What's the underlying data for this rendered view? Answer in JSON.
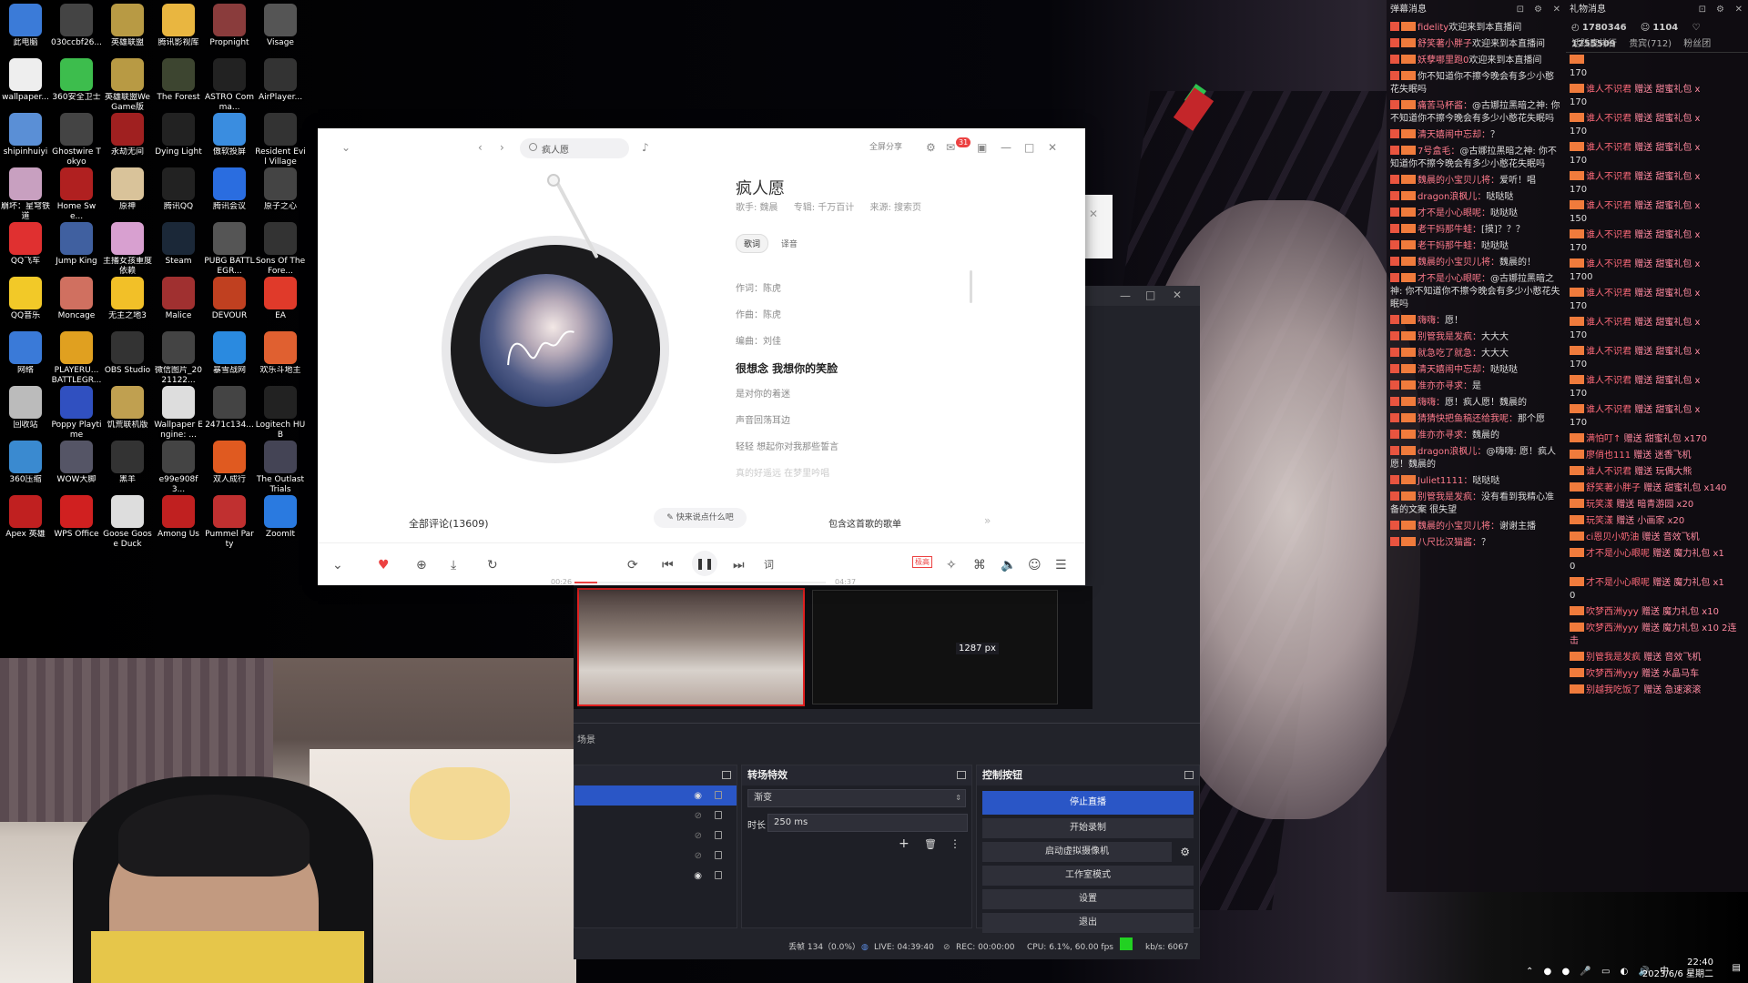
{
  "desktop": {
    "icons": [
      {
        "label": "此电脑",
        "color": "#3b7bd8"
      },
      {
        "label": "030ccbf26...",
        "color": "#444"
      },
      {
        "label": "英雄联盟",
        "color": "#b89a44"
      },
      {
        "label": "腾讯影视库",
        "color": "#e9b640"
      },
      {
        "label": "Propnight",
        "color": "#8a3c3c"
      },
      {
        "label": "Visage",
        "color": "#555"
      },
      {
        "label": "wallpaper...",
        "color": "#eee"
      },
      {
        "label": "360安全卫士",
        "color": "#3dbd4d"
      },
      {
        "label": "英雄联盟WeGame版",
        "color": "#b89a44"
      },
      {
        "label": "The Forest",
        "color": "#3d4530"
      },
      {
        "label": "ASTRO Comma...",
        "color": "#222"
      },
      {
        "label": "AirPlayer...",
        "color": "#333"
      },
      {
        "label": "shipinhuiyi",
        "color": "#5a8fd6"
      },
      {
        "label": "Ghostwire Tokyo",
        "color": "#444"
      },
      {
        "label": "永劫无间",
        "color": "#a02020"
      },
      {
        "label": "Dying Light",
        "color": "#222"
      },
      {
        "label": "傲软投屏",
        "color": "#3a8de0"
      },
      {
        "label": "Resident Evil Village",
        "color": "#333"
      },
      {
        "label": "崩坏：星穹铁道",
        "color": "#c8a0c0"
      },
      {
        "label": "Home Swe...",
        "color": "#b02020"
      },
      {
        "label": "原神",
        "color": "#d9c39a"
      },
      {
        "label": "腾讯QQ",
        "color": "#222"
      },
      {
        "label": "腾讯会议",
        "color": "#2a6de0"
      },
      {
        "label": "原子之心",
        "color": "#444"
      },
      {
        "label": "QQ飞车",
        "color": "#e03030"
      },
      {
        "label": "Jump King",
        "color": "#4060a0"
      },
      {
        "label": "主播女孩重度依赖",
        "color": "#d8a0d0"
      },
      {
        "label": "Steam",
        "color": "#1b2838"
      },
      {
        "label": "PUBG BATTLEGR...",
        "color": "#555"
      },
      {
        "label": "Sons Of The Fore...",
        "color": "#333"
      },
      {
        "label": "QQ音乐",
        "color": "#f2c928"
      },
      {
        "label": "Moncage",
        "color": "#d07060"
      },
      {
        "label": "无主之地3",
        "color": "#f2c028"
      },
      {
        "label": "Malice",
        "color": "#a03030"
      },
      {
        "label": "DEVOUR",
        "color": "#c04020"
      },
      {
        "label": "EA",
        "color": "#e03a2a"
      },
      {
        "label": "网络",
        "color": "#3a7ad8"
      },
      {
        "label": "PLAYERU... BATTLEGR...",
        "color": "#e0a020"
      },
      {
        "label": "OBS Studio",
        "color": "#333"
      },
      {
        "label": "微信图片_2021122...",
        "color": "#444"
      },
      {
        "label": "暴雪战网",
        "color": "#2a8ae0"
      },
      {
        "label": "欢乐斗地主",
        "color": "#e06030"
      },
      {
        "label": "回收站",
        "color": "#bbb"
      },
      {
        "label": "Poppy Playtime",
        "color": "#3050c0"
      },
      {
        "label": "饥荒联机版",
        "color": "#c0a050"
      },
      {
        "label": "Wallpaper Engine: ...",
        "color": "#ddd"
      },
      {
        "label": "2471c134...",
        "color": "#444"
      },
      {
        "label": "Logitech HUB",
        "color": "#222"
      },
      {
        "label": "360压缩",
        "color": "#3a8ad0"
      },
      {
        "label": "WOW大脚",
        "color": "#556"
      },
      {
        "label": "黑羊",
        "color": "#333"
      },
      {
        "label": "e99e908f3...",
        "color": "#444"
      },
      {
        "label": "双人成行",
        "color": "#e05a20"
      },
      {
        "label": "The Outlast Trials",
        "color": "#445"
      },
      {
        "label": "Apex 英雄",
        "color": "#c02020"
      },
      {
        "label": "WPS Office",
        "color": "#d02020"
      },
      {
        "label": "Goose Goose Duck",
        "color": "#ddd"
      },
      {
        "label": "Among Us",
        "color": "#c02020"
      },
      {
        "label": "Pummel Party",
        "color": "#c03030"
      },
      {
        "label": "ZoomIt",
        "color": "#2a7ae0"
      }
    ]
  },
  "player": {
    "search_text": "疯人愿",
    "share_label": "全屏分享",
    "badge": "31",
    "song_title": "疯人愿",
    "singer_label": "歌手: 魏晨",
    "album_label": "专辑: 千万百计",
    "source_label": "来源: 搜索页",
    "tabs": [
      "歌词",
      "译音"
    ],
    "lyrics": [
      "作词：陈虎",
      "作曲：陈虎",
      "编曲：刘佳",
      "很想念 我想你的笑脸",
      "是对你的着迷",
      "声音回荡耳边",
      "轻轻 想起你对我那些誓言",
      "真的好遥远 在梦里吟唱"
    ],
    "comments_label": "全部评论(13609)",
    "quick_comment": "快来说点什么吧",
    "contains_label": "包含这首歌的歌单",
    "time_current": "00:26",
    "time_total": "04:37",
    "progress": 0.09,
    "hq_label": "极高",
    "lyric_btn": "词"
  },
  "obs": {
    "preview_px": "1287 px",
    "scene_tab": "场景",
    "transitions_title": "转场特效",
    "transition_value": "渐变",
    "duration_label": "时长",
    "duration_value": "250 ms",
    "controls_title": "控制按钮",
    "controls": [
      "停止直播",
      "开始录制",
      "启动虚拟摄像机",
      "工作室模式",
      "设置",
      "退出"
    ],
    "status": {
      "dropped": "丢帧 134（0.0%）",
      "live": "LIVE: 04:39:40",
      "rec": "REC: 00:00:00",
      "cpu": "CPU: 6.1%, 60.00 fps",
      "kbs": "kb/s: 6067"
    }
  },
  "chat": {
    "title": "弹幕消息",
    "messages": [
      {
        "user": "fidelity",
        "text": "欢迎来到本直播间"
      },
      {
        "user": "舒笑著小胖子",
        "text": "欢迎来到本直播间"
      },
      {
        "user": "妖孽哪里跑0",
        "text": "欢迎来到本直播间"
      },
      {
        "user": "",
        "text": "你不知道你不擦今晚会有多少小憨花失眠吗"
      },
      {
        "user": "痛苦马杯酱：",
        "text": "@古娜拉黑暗之神: 你不知道你不擦今晚会有多少小憨花失眠吗"
      },
      {
        "user": "清天嬉闹中忘却：",
        "text": "？"
      },
      {
        "user": "7号盒毛：",
        "text": "@古娜拉黑暗之神: 你不知道你不擦今晚会有多少小憨花失眠吗"
      },
      {
        "user": "魏晨的小宝贝儿将：",
        "text": "爱听！唱"
      },
      {
        "user": "dragon浪枫儿：",
        "text": "哒哒哒"
      },
      {
        "user": "才不是小心眼呢：",
        "text": "哒哒哒"
      },
      {
        "user": "老干妈那牛蛙：",
        "text": "[摸]？？？"
      },
      {
        "user": "老干妈那牛蛙：",
        "text": "哒哒哒"
      },
      {
        "user": "魏晨的小宝贝儿将：",
        "text": "魏晨的！"
      },
      {
        "user": "才不是小心眼呢：",
        "text": "@古娜拉黑暗之神: 你不知道你不擦今晚会有多少小憨花失眠吗"
      },
      {
        "user": "嗨嗨：",
        "text": "愿！"
      },
      {
        "user": "别管我是发疯：",
        "text": "大大大"
      },
      {
        "user": "就急吃了就急：",
        "text": "大大大"
      },
      {
        "user": "清天嬉闹中忘却：",
        "text": "哒哒哒"
      },
      {
        "user": "准亦亦寻求：",
        "text": "是"
      },
      {
        "user": "嗨嗨：",
        "text": "愿！疯人愿！魏晨的"
      },
      {
        "user": "猜猜快把鱼稿还给我呢：",
        "text": "那个愿"
      },
      {
        "user": "准亦亦寻求：",
        "text": "魏晨的"
      },
      {
        "user": "dragon浪枫儿：",
        "text": "@嗨嗨: 愿！疯人愿！魏晨的"
      },
      {
        "user": "Juliet1111：",
        "text": "哒哒哒"
      },
      {
        "user": "别管我是发疯：",
        "text": "没有看到我精心准备的文案 很失望"
      },
      {
        "user": "魏晨的小宝贝儿将：",
        "text": "谢谢主播"
      },
      {
        "user": "八尺比汉猫酱：",
        "text": "？"
      }
    ]
  },
  "gifts": {
    "title": "礼物消息",
    "stats": [
      "1780346",
      "1104",
      "1755509"
    ],
    "tabs": [
      "活跃度排行",
      "贵宾(712)",
      "粉丝团"
    ],
    "messages": [
      {
        "user": "",
        "text": "",
        "qty": "170"
      },
      {
        "user": "谁人不识君",
        "text": "赠送 甜蜜礼包 x",
        "qty": "170"
      },
      {
        "user": "谁人不识君",
        "text": "赠送 甜蜜礼包 x",
        "qty": "170"
      },
      {
        "user": "谁人不识君",
        "text": "赠送 甜蜜礼包 x",
        "qty": "170"
      },
      {
        "user": "谁人不识君",
        "text": "赠送 甜蜜礼包 x",
        "qty": "170"
      },
      {
        "user": "谁人不识君",
        "text": "赠送 甜蜜礼包 x",
        "qty": "150"
      },
      {
        "user": "谁人不识君",
        "text": "赠送 甜蜜礼包 x",
        "qty": "170"
      },
      {
        "user": "谁人不识君",
        "text": "赠送 甜蜜礼包 x",
        "qty": "1700"
      },
      {
        "user": "谁人不识君",
        "text": "赠送 甜蜜礼包 x",
        "qty": "170"
      },
      {
        "user": "谁人不识君",
        "text": "赠送 甜蜜礼包 x",
        "qty": "170"
      },
      {
        "user": "谁人不识君",
        "text": "赠送 甜蜜礼包 x",
        "qty": "170"
      },
      {
        "user": "谁人不识君",
        "text": "赠送 甜蜜礼包 x",
        "qty": "170"
      },
      {
        "user": "谁人不识君",
        "text": "赠送 甜蜜礼包 x",
        "qty": "170"
      },
      {
        "user": "满怕叮↑",
        "text": "赠送 甜蜜礼包 x170",
        "qty": ""
      },
      {
        "user": "廖俏也111",
        "text": "赠送 迷香飞机",
        "qty": ""
      },
      {
        "user": "谁人不识君",
        "text": "赠送 玩偶大熊",
        "qty": ""
      },
      {
        "user": "舒笑著小胖子",
        "text": "赠送 甜蜜礼包 x140",
        "qty": ""
      },
      {
        "user": "玩笑漾",
        "text": "赠送 暗青游园 x20",
        "qty": ""
      },
      {
        "user": "玩笑漾",
        "text": "赠送 小画家 x20",
        "qty": ""
      },
      {
        "user": "ci恩贝小奶油",
        "text": "赠送 音效飞机",
        "qty": ""
      },
      {
        "user": "才不是小心眼呢",
        "text": "赠送 魔力礼包 x1",
        "qty": "0"
      },
      {
        "user": "才不是小心眼呢",
        "text": "赠送 魔力礼包 x1",
        "qty": "0"
      },
      {
        "user": "吹梦西洲yyy",
        "text": "赠送 魔力礼包 x10",
        "qty": ""
      },
      {
        "user": "吹梦西洲yyy",
        "text": "赠送 魔力礼包 x10 2连击",
        "qty": ""
      },
      {
        "user": "别管我是发疯",
        "text": "赠送 音效飞机",
        "qty": ""
      },
      {
        "user": "吹梦西洲yyy",
        "text": "赠送 水晶马车",
        "qty": ""
      },
      {
        "user": "别越我吃饭了",
        "text": "赠送 急速滚滚",
        "qty": ""
      }
    ]
  },
  "taskbar": {
    "time": "22:40",
    "date": "2023/6/6 星期二",
    "ime": "中"
  }
}
